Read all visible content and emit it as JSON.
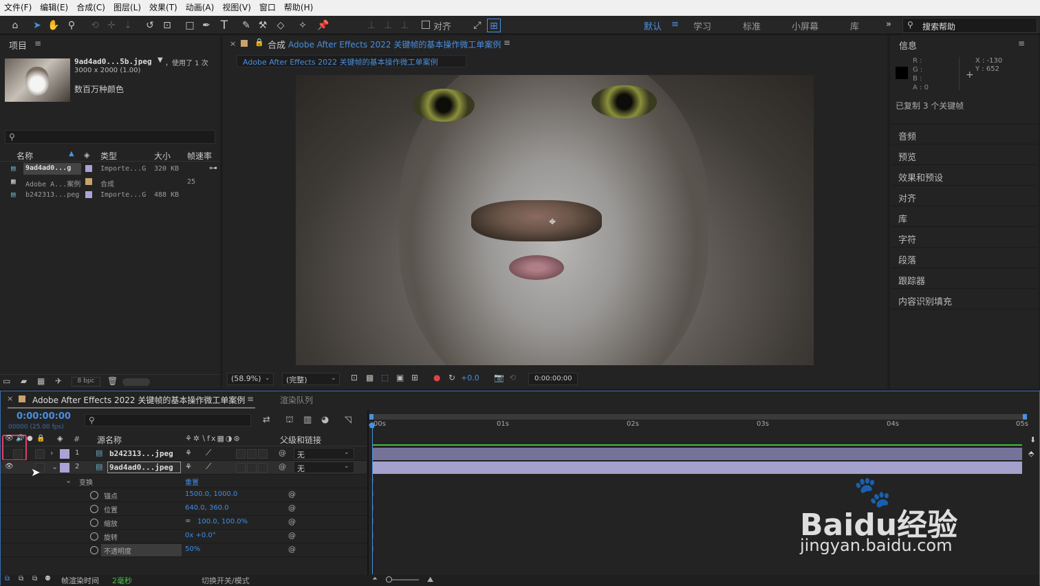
{
  "menu": [
    "文件(F)",
    "编辑(E)",
    "合成(C)",
    "图层(L)",
    "效果(T)",
    "动画(A)",
    "视图(V)",
    "窗口",
    "帮助(H)"
  ],
  "toolbar": {
    "align_label": "对齐",
    "workspaces": [
      "默认",
      "学习",
      "标准",
      "小屏幕",
      "库"
    ],
    "active_workspace": "默认",
    "search_placeholder": "搜索帮助"
  },
  "project": {
    "title": "项目",
    "file_name": "9ad4ad0...5b.jpeg",
    "used": "，使用了 1 次",
    "dims": "3000 x 2000 (1.00)",
    "colors": "数百万种颜色",
    "columns": [
      "名称",
      "类型",
      "大小",
      "帧速率"
    ],
    "rows": [
      {
        "name": "9ad4ad0...g",
        "type": "Importe...G",
        "size": "320 KB",
        "fps": ""
      },
      {
        "name": "Adobe A...案例",
        "type": "合成",
        "size": "",
        "fps": "25"
      },
      {
        "name": "b242313...peg",
        "type": "Importe...G",
        "size": "488 KB",
        "fps": ""
      }
    ],
    "bpc": "8 bpc"
  },
  "comp": {
    "tab_prefix": "合成",
    "tab_name": "Adobe After Effects 2022 关键帧的基本操作微工单案例",
    "subtab": "Adobe After Effects 2022 关键帧的基本操作微工单案例",
    "zoom": "(58.9%)",
    "resolution": "(完整)",
    "exposure": "+0.0",
    "timecode": "0:00:00:00"
  },
  "info": {
    "title": "信息",
    "r": "R :",
    "g": "G :",
    "b": "B :",
    "a": "A : 0",
    "x": "X : -130",
    "y": "Y : 652",
    "msg": "已复制 3 个关键帧"
  },
  "side_panels": [
    "音频",
    "预览",
    "效果和预设",
    "对齐",
    "库",
    "字符",
    "段落",
    "跟踪器",
    "内容识别填充"
  ],
  "timeline": {
    "tab_name": "Adobe After Effects 2022 关键帧的基本操作微工单案例",
    "render_tab": "渲染队列",
    "timecode": "0:00:00:00",
    "frames": "00000 (25.00 fps)",
    "col_num": "#",
    "col_source": "源名称",
    "col_parent": "父级和链接",
    "layers": [
      {
        "num": "1",
        "name": "b242313...jpeg",
        "parent": "无"
      },
      {
        "num": "2",
        "name": "9ad4ad0...jpeg",
        "parent": "无"
      }
    ],
    "transform": "变换",
    "reset": "重置",
    "props": [
      {
        "name": "锚点",
        "value": "1500.0, 1000.0"
      },
      {
        "name": "位置",
        "value": "640.0, 360.0"
      },
      {
        "name": "缩放",
        "value": "100.0, 100.0%"
      },
      {
        "name": "旋转",
        "value": "0x +0.0°"
      },
      {
        "name": "不透明度",
        "value": "50%"
      }
    ],
    "ruler": [
      "00s",
      "01s",
      "02s",
      "03s",
      "04s",
      "05s"
    ],
    "footer_render": "帧渲染时间",
    "footer_ms": "2毫秒",
    "footer_toggle": "切换开关/模式"
  },
  "watermark": {
    "brand": "Baidu经验",
    "url": "jingyan.baidu.com"
  }
}
